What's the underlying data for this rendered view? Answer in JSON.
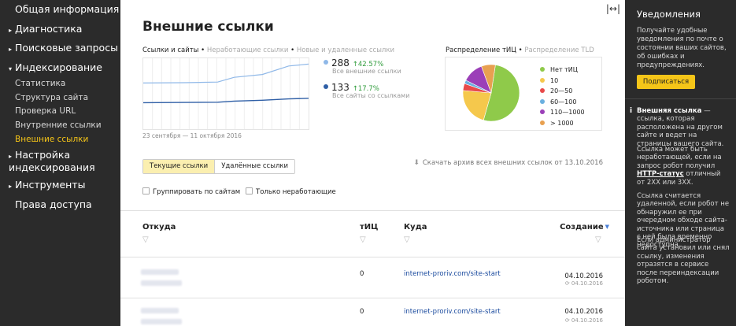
{
  "sidebar": {
    "items": [
      {
        "label": "Общая информация",
        "arrow": ""
      },
      {
        "label": "Диагностика",
        "arrow": "▸"
      },
      {
        "label": "Поисковые запросы",
        "arrow": "▸"
      },
      {
        "label": "Индексирование",
        "arrow": "▾"
      }
    ],
    "sub_items": [
      {
        "label": "Статистика"
      },
      {
        "label": "Структура сайта"
      },
      {
        "label": "Проверка URL"
      },
      {
        "label": "Внутренние ссылки"
      },
      {
        "label": "Внешние ссылки",
        "active": true
      }
    ],
    "items_after": [
      {
        "label_line1": "Настройка",
        "label_line2": "индексирования",
        "arrow": "▸"
      },
      {
        "label": "Инструменты",
        "arrow": "▸"
      },
      {
        "label": "Права доступа",
        "arrow": ""
      }
    ]
  },
  "main": {
    "expand_glyph": "|↔|",
    "title": "Внешние ссылки",
    "chart_legend": {
      "active": "Ссылки и сайты",
      "sep1": " • ",
      "opt2": "Неработающие ссылки",
      "sep2": " • ",
      "opt3": "Новые и удаленные ссылки"
    },
    "chart_dates": "23 сентября — 11 октября 2016",
    "stats": [
      {
        "value": "288",
        "delta": "↑42.57%",
        "caption": "Все внешние ссылки",
        "color": "#8fb8e8"
      },
      {
        "value": "133",
        "delta": "↑17.7%",
        "caption": "Все сайты со ссылками",
        "color": "#2f5fa6"
      }
    ],
    "pie_header": {
      "active": "Распределение тИЦ",
      "sep": " • ",
      "opt2": "Распределение TLD"
    },
    "pie_legend": [
      {
        "label": "Нет тИЦ",
        "color": "#8fca4a"
      },
      {
        "label": "10",
        "color": "#f5c84c"
      },
      {
        "label": "20—50",
        "color": "#e84a4a"
      },
      {
        "label": "60—100",
        "color": "#6ab0e0"
      },
      {
        "label": "110—1000",
        "color": "#9b3fb8"
      },
      {
        "label": "> 1000",
        "color": "#e8a050"
      }
    ],
    "tabs": [
      {
        "label": "Текущие ссылки",
        "active": true
      },
      {
        "label": "Удалённые ссылки",
        "active": false
      }
    ],
    "download_label": "Скачать архив всех внешних ссылок от 13.10.2016",
    "checkboxes": [
      {
        "label": "Группировать по сайтам"
      },
      {
        "label": "Только неработающие"
      }
    ],
    "table": {
      "headers": {
        "from": "Откуда",
        "tic": "тИЦ",
        "to": "Куда",
        "created": "Создание"
      },
      "rows": [
        {
          "tic": "0",
          "to": "internet-proriv.com/site-start",
          "date": "04.10.2016",
          "subdate": "04.10.2016"
        },
        {
          "tic": "0",
          "to": "internet-proriv.com/site-start",
          "date": "04.10.2016",
          "subdate": "04.10.2016"
        }
      ]
    }
  },
  "rightpanel": {
    "title": "Уведомления",
    "text": "Получайте удобные уведомления по почте о состоянии ваших сайтов, об ошибках и предупреждениях.",
    "subscribe": "Подписаться",
    "info_icon": "i",
    "info_term": "Внешняя ссылка",
    "info_p1_rest": " — ссылка, которая расположена на другом сайте и ведет на страницы вашего сайта.",
    "info_p2_a": "Ссылка может быть неработающей, если на запрос робот получил ",
    "info_p2_link": "HTTP-статус",
    "info_p2_b": " отличный от 2XX или 3XX.",
    "info_p3": "Ссылка считается удаленной, если робот не обнаружил ее при очередном обходе сайта-источника или страница с ней была временно недоступна.",
    "info_p4": "Если администратор сайта установил или снял ссылку, изменения отразятся в сервисе после переиндексации роботом."
  },
  "chart_data": [
    {
      "type": "line",
      "x": [
        "23.09.2016",
        "11.10.2016"
      ],
      "series": [
        {
          "name": "Все внешние ссылки",
          "values": [
            202,
            288
          ]
        },
        {
          "name": "Все сайты со ссылками",
          "values": [
            113,
            133
          ]
        }
      ],
      "xlabel": "23 сентября — 11 октября 2016",
      "grid": true
    },
    {
      "type": "pie",
      "categories": [
        "Нет тИЦ",
        "10",
        "20—50",
        "60—100",
        "110—1000",
        "> 1000"
      ],
      "values": [
        52,
        22,
        4,
        2,
        12,
        8
      ]
    }
  ]
}
